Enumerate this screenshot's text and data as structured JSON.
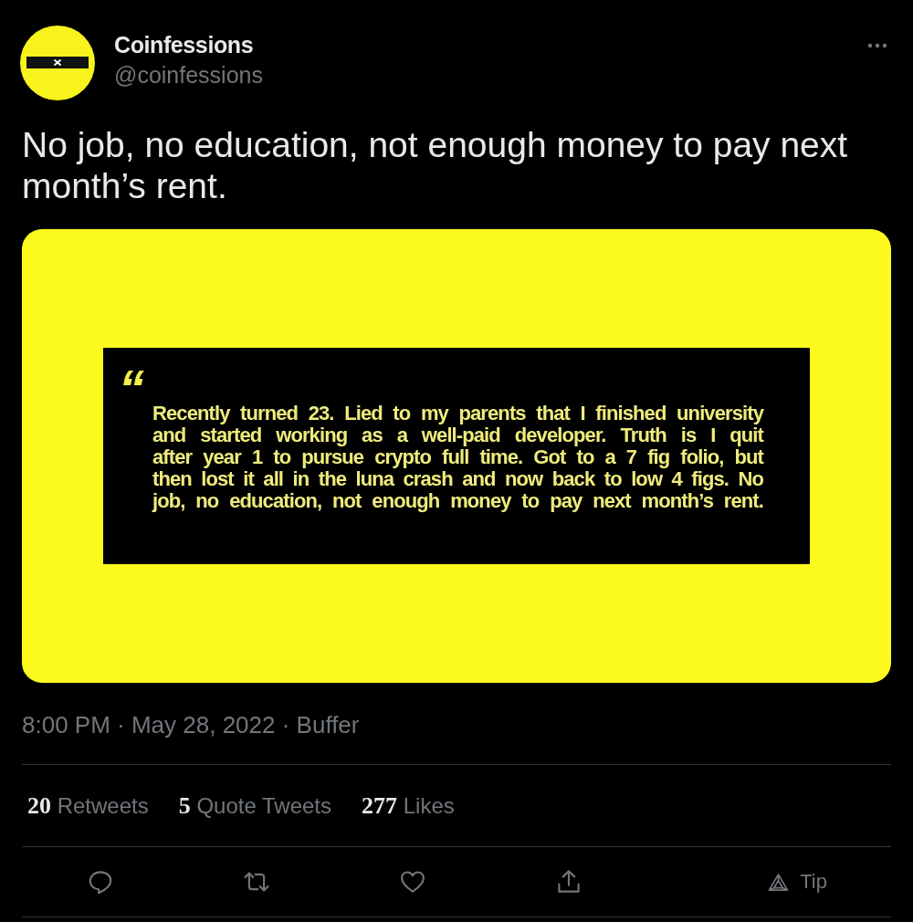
{
  "author": {
    "name": "Coinfessions",
    "handle": "@coinfessions"
  },
  "text": "No job, no education, not enough money to pay next month’s rent.",
  "media": {
    "quote_mark": "“",
    "quote": "Recently turned 23. Lied to my parents that I finished university\nand started working as a well-paid developer. Truth is I quit\nafter year 1 to pursue crypto full time. Got to a 7 fig folio, but\nthen lost it all in the luna crash and now back to low 4 figs. No\njob, no education, not enough money to pay next month’s rent."
  },
  "meta": "8:00 PM · May 28, 2022 · Buffer",
  "stats": [
    {
      "count": "20",
      "label": "Retweets"
    },
    {
      "count": "5",
      "label": "Quote Tweets"
    },
    {
      "count": "277",
      "label": "Likes"
    }
  ],
  "actions": [
    {
      "kind": "reply"
    },
    {
      "kind": "retweet"
    },
    {
      "kind": "like"
    },
    {
      "kind": "share"
    },
    {
      "kind": "tip",
      "label": "Tip"
    }
  ]
}
